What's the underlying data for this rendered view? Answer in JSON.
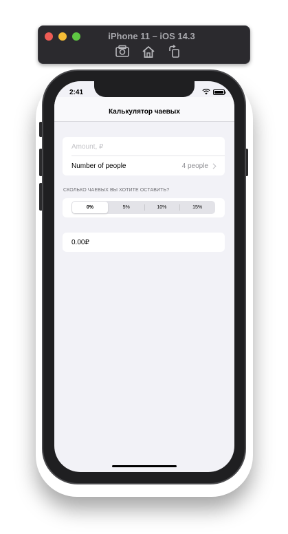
{
  "simulator": {
    "title": "iPhone 11 – iOS 14.3",
    "tools": [
      "screenshot-icon",
      "home-icon",
      "rotate-icon"
    ]
  },
  "status_bar": {
    "time": "2:41"
  },
  "navbar": {
    "title": "Калькулятор чаевых"
  },
  "form": {
    "amount": {
      "value": "",
      "placeholder": "Amount, ₽"
    },
    "people": {
      "label": "Number of people",
      "value": "4 people"
    },
    "tip_section_header": "СКОЛЬКО ЧАЕВЫХ ВЫ ХОТИТЕ ОСТАВИТЬ?",
    "tip_options": [
      "0%",
      "5%",
      "10%",
      "15%"
    ],
    "tip_selected": "0%",
    "total": "0.00₽"
  },
  "colors": {
    "background": "#f2f2f7",
    "secondary_text": "#8e8e93",
    "placeholder": "#c4c4c8"
  }
}
